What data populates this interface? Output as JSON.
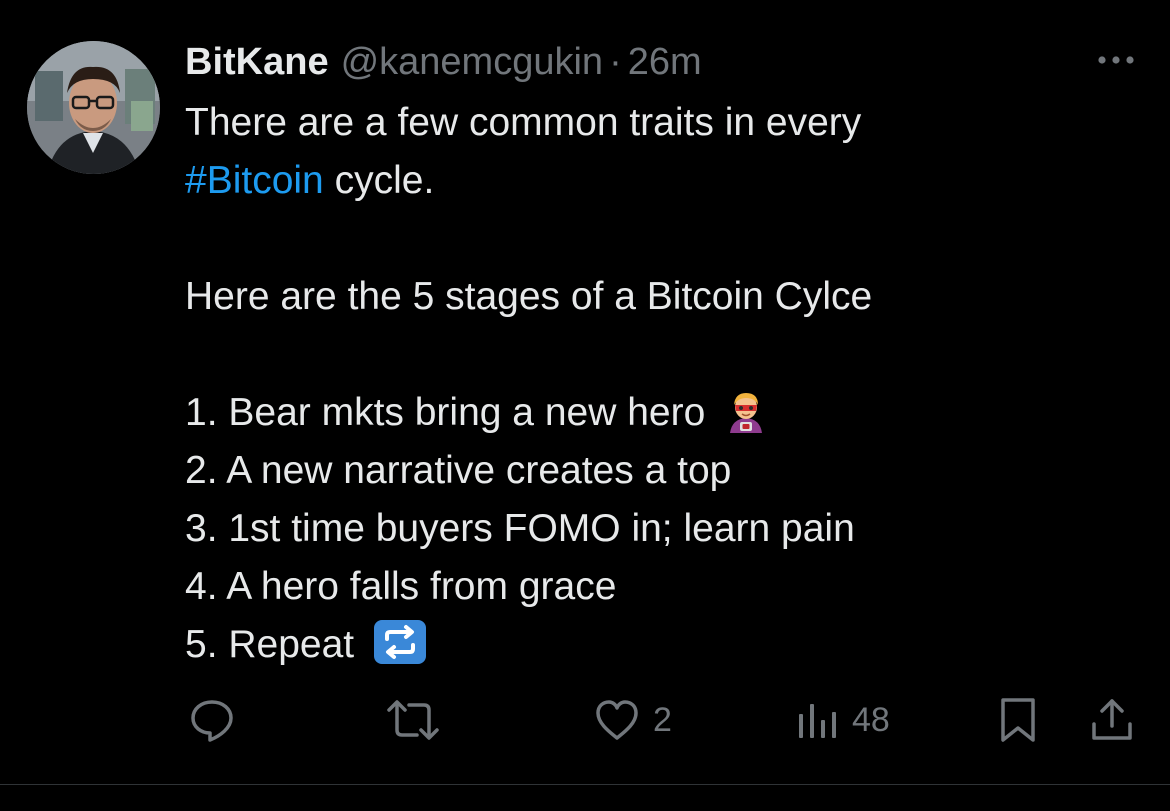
{
  "tweet": {
    "display_name": "BitKane",
    "handle": "@kanemcgukin",
    "separator": "·",
    "time": "26m",
    "lines": [
      "There are a few common traits in every",
      "#Bitcoin",
      " cycle.",
      "Here are the 5 stages of a Bitcoin Cylce",
      "1. Bear mkts bring a new hero",
      "2. A new narrative creates a top",
      "3. 1st time buyers FOMO in; learn pain",
      "4. A hero falls from grace",
      "5. Repeat"
    ]
  },
  "actions": {
    "reply_icon": "reply-icon",
    "repost_icon": "repost-icon",
    "like_icon": "heart-icon",
    "like_count": "2",
    "views_icon": "views-icon",
    "views_count": "48",
    "bookmark_icon": "bookmark-icon",
    "share_icon": "share-icon"
  },
  "colors": {
    "background": "#000000",
    "text": "#e7e9ea",
    "secondary": "#71767b",
    "link": "#1d9bf0",
    "divider": "#2f3336"
  }
}
